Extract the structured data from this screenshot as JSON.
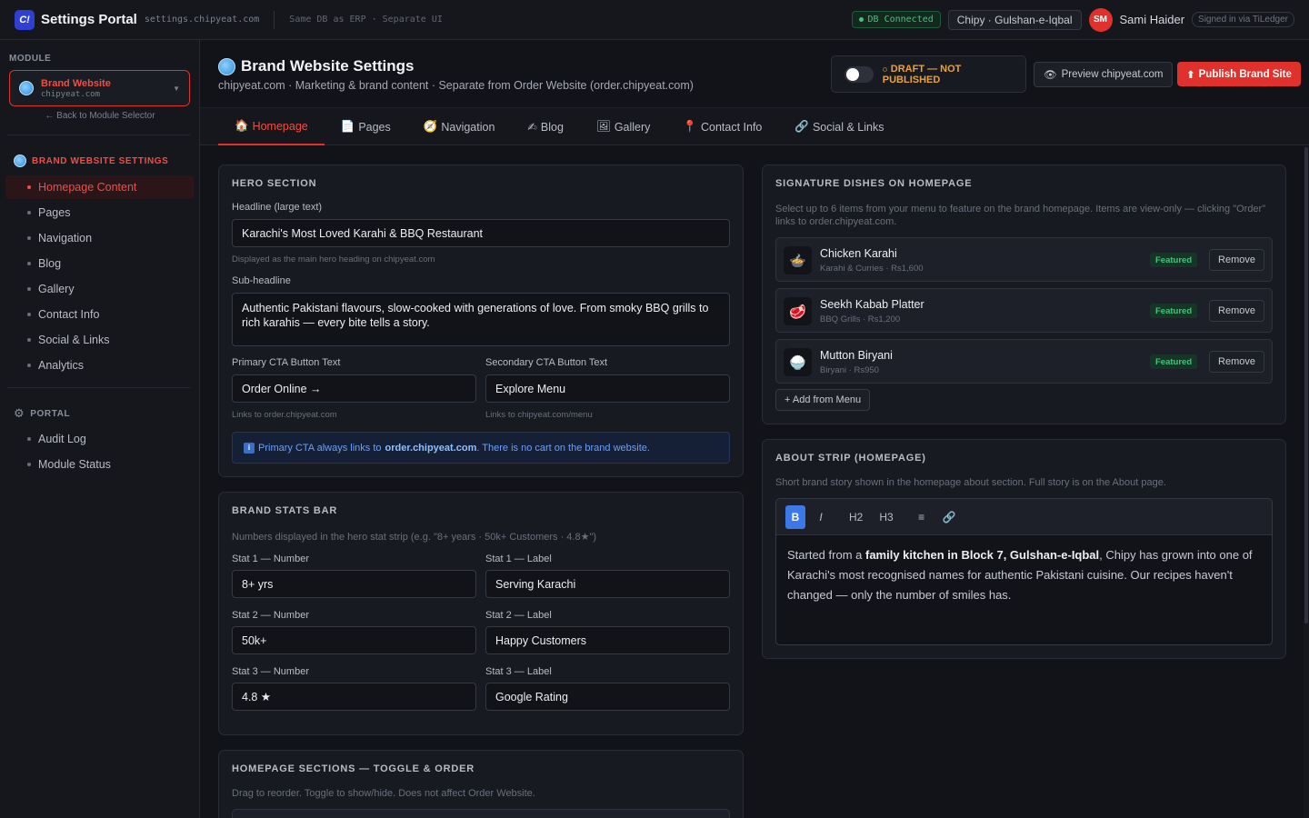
{
  "app": {
    "logo": "C!",
    "title": "Settings Portal",
    "domain": "settings.chipyeat.com",
    "note": "Same DB as ERP · Separate UI"
  },
  "topbar": {
    "db_status": "DB Connected",
    "branch": "Chipy · Gulshan-e-Iqbal",
    "avatar_initials": "SM",
    "user_name": "Sami Haider",
    "signed_in": "Signed in via TiLedger"
  },
  "sidebar": {
    "module_label": "MODULE",
    "module_name": "Brand Website",
    "module_domain": "chipyeat.com",
    "back_link": "← Back to Module Selector",
    "section1": "BRAND WEBSITE SETTINGS",
    "items": [
      "Homepage Content",
      "Pages",
      "Navigation",
      "Blog",
      "Gallery",
      "Contact Info",
      "Social & Links",
      "Analytics"
    ],
    "section2": "PORTAL",
    "portal_items": [
      "Audit Log",
      "Module Status"
    ]
  },
  "header": {
    "title": "Brand Website Settings",
    "subtitle": "chipyeat.com · Marketing & brand content · Separate from Order Website (order.chipyeat.com)",
    "draft_status": "DRAFT — NOT PUBLISHED",
    "preview_label": "Preview chipyeat.com",
    "publish_label": "Publish Brand Site"
  },
  "tabs": [
    {
      "icon": "🏠",
      "label": "Homepage"
    },
    {
      "icon": "📄",
      "label": "Pages"
    },
    {
      "icon": "🧭",
      "label": "Navigation"
    },
    {
      "icon": "✍",
      "label": "Blog"
    },
    {
      "icon": "🖼",
      "label": "Gallery"
    },
    {
      "icon": "📍",
      "label": "Contact Info"
    },
    {
      "icon": "🔗",
      "label": "Social & Links"
    }
  ],
  "hero": {
    "title": "HERO SECTION",
    "headline_label": "Headline (large text)",
    "headline_value": "Karachi's Most Loved Karahi & BBQ Restaurant",
    "headline_hint": "Displayed as the main hero heading on chipyeat.com",
    "subheadline_label": "Sub-headline",
    "subheadline_value": "Authentic Pakistani flavours, slow-cooked with generations of love. From smoky BBQ grills to rich karahis — every bite tells a story.",
    "primary_cta_label": "Primary CTA Button Text",
    "primary_cta_value": "Order Online →",
    "primary_cta_hint": "Links to order.chipyeat.com",
    "secondary_cta_label": "Secondary CTA Button Text",
    "secondary_cta_value": "Explore Menu",
    "secondary_cta_hint": "Links to chipyeat.com/menu",
    "info_prefix": "Primary CTA always links to",
    "info_link": "order.chipyeat.com",
    "info_suffix": ". There is no cart on the brand website."
  },
  "stats": {
    "title": "BRAND STATS BAR",
    "description": "Numbers displayed in the hero stat strip (e.g. \"8+ years · 50k+ Customers · 4.8★\")",
    "rows": [
      {
        "num_label": "Stat 1 — Number",
        "num_value": "8+ yrs",
        "text_label": "Stat 1 — Label",
        "text_value": "Serving Karachi"
      },
      {
        "num_label": "Stat 2 — Number",
        "num_value": "50k+",
        "text_label": "Stat 2 — Label",
        "text_value": "Happy Customers"
      },
      {
        "num_label": "Stat 3 — Number",
        "num_value": "4.8 ★",
        "text_label": "Stat 3 — Label",
        "text_value": "Google Rating"
      }
    ]
  },
  "sections": {
    "title": "HOMEPAGE SECTIONS — TOGGLE & ORDER",
    "description": "Drag to reorder. Toggle to show/hide. Does not affect Order Website."
  },
  "dishes": {
    "title": "SIGNATURE DISHES ON HOMEPAGE",
    "description": "Select up to 6 items from your menu to feature on the brand homepage. Items are view-only — clicking \"Order\" links to order.chipyeat.com.",
    "items": [
      {
        "icon": "🍲",
        "name": "Chicken Karahi",
        "meta": "Karahi & Curries · Rs1,600",
        "badge": "Featured",
        "remove": "Remove"
      },
      {
        "icon": "🥩",
        "name": "Seekh Kabab Platter",
        "meta": "BBQ Grills · Rs1,200",
        "badge": "Featured",
        "remove": "Remove"
      },
      {
        "icon": "🍚",
        "name": "Mutton Biryani",
        "meta": "Biryani · Rs950",
        "badge": "Featured",
        "remove": "Remove"
      }
    ],
    "add_label": "+ Add from Menu"
  },
  "about": {
    "title": "ABOUT STRIP (HOMEPAGE)",
    "description": "Short brand story shown in the homepage about section. Full story is on the About page.",
    "toolbar": [
      "B",
      "I",
      "H2",
      "H3",
      "≡",
      "🔗"
    ],
    "text_start": "Started from a ",
    "text_bold": "family kitchen in Block 7, Gulshan-e-Iqbal",
    "text_end": ", Chipy has grown into one of Karachi's most recognised names for authentic Pakistani cuisine. Our recipes haven't changed — only the number of smiles has."
  },
  "colors": {
    "accent": "#e0312c",
    "success": "#43c47b",
    "warning": "#e8a23b",
    "info": "#6aa0f5"
  }
}
